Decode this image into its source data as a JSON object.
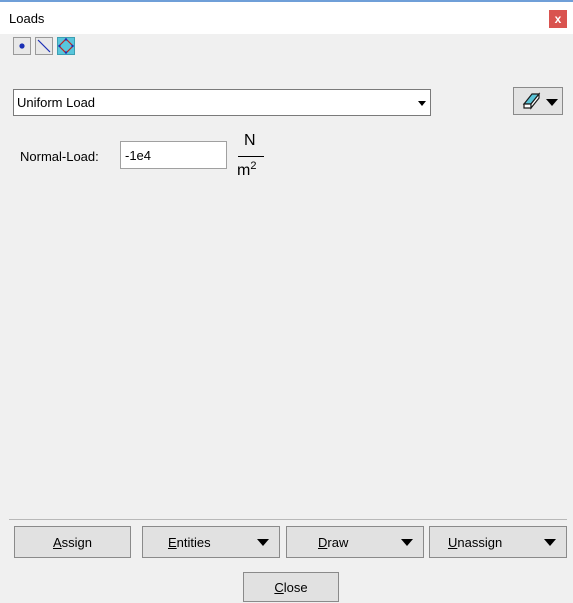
{
  "window": {
    "title": "Loads",
    "close_glyph": "x"
  },
  "toolbar": {
    "buttons": [
      {
        "icon": "point-icon",
        "active": false
      },
      {
        "icon": "line-icon",
        "active": false
      },
      {
        "icon": "surface-icon",
        "active": true
      }
    ]
  },
  "load_type": {
    "selected": "Uniform Load",
    "eraser_icon": "eraser-icon"
  },
  "field": {
    "label": "Normal-Load:",
    "value": "-1e4",
    "unit_numerator": "N",
    "unit_denominator": "m",
    "unit_exponent": "2"
  },
  "actions": {
    "assign": {
      "accel": "A",
      "rest": "ssign"
    },
    "entities": {
      "accel": "E",
      "rest": "ntities"
    },
    "draw": {
      "accel": "D",
      "rest": "raw"
    },
    "unassign": {
      "accel": "U",
      "rest": "nassign"
    },
    "close": {
      "accel": "C",
      "rest": "lose"
    }
  }
}
